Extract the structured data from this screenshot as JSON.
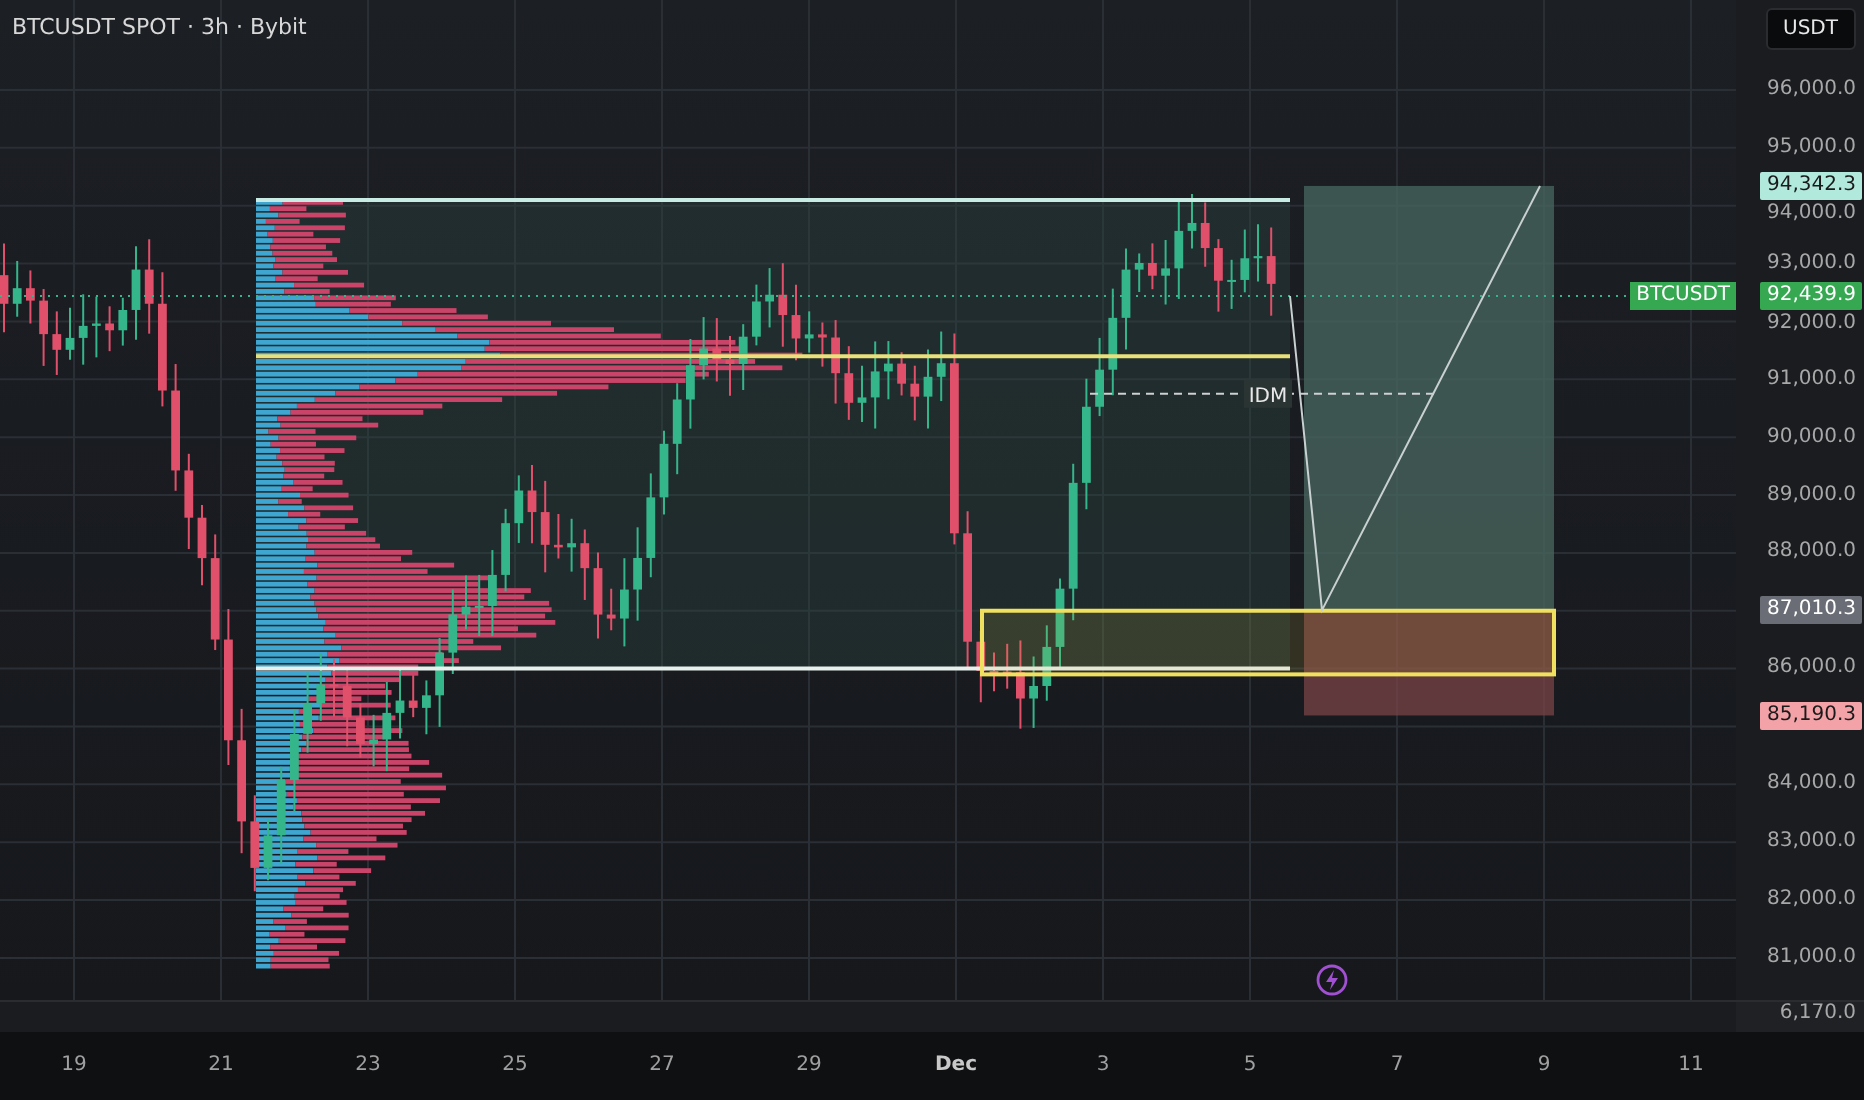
{
  "header": {
    "title": "BTCUSDT SPOT · 3h · Bybit"
  },
  "currency_button": "USDT",
  "price_axis": {
    "ticks": [
      "96,000.0",
      "95,000.0",
      "94,000.0",
      "93,000.0",
      "92,000.0",
      "91,000.0",
      "90,000.0",
      "89,000.0",
      "88,000.0",
      "86,000.0",
      "84,000.0",
      "83,000.0",
      "82,000.0",
      "81,000.0"
    ],
    "badges": [
      {
        "label": "94,342.3",
        "kind": "target"
      },
      {
        "label": "92,439.9",
        "kind": "last",
        "symbol": "BTCUSDT"
      },
      {
        "label": "87,010.3",
        "kind": "entry"
      },
      {
        "label": "85,190.3",
        "kind": "stop"
      }
    ]
  },
  "chart": {
    "annotation": "IDM"
  },
  "lower_pane": {
    "value": "6,170.0"
  },
  "time_axis": [
    "19",
    "21",
    "23",
    "25",
    "27",
    "29",
    "Dec",
    "3",
    "5",
    "7",
    "9",
    "11"
  ]
}
